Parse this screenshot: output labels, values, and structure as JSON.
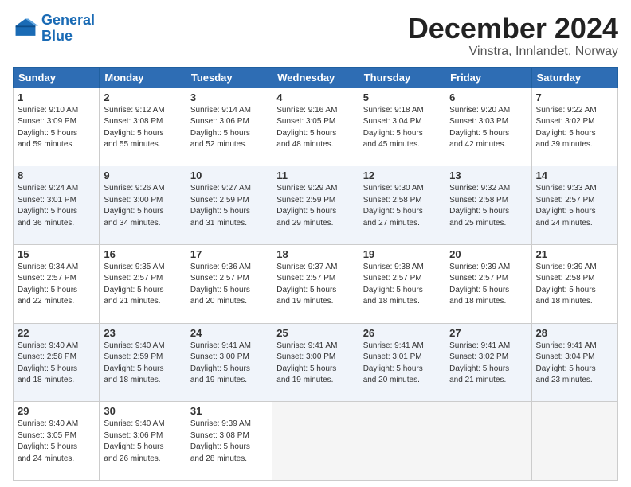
{
  "logo": {
    "line1": "General",
    "line2": "Blue"
  },
  "title": "December 2024",
  "subtitle": "Vinstra, Innlandet, Norway",
  "days_of_week": [
    "Sunday",
    "Monday",
    "Tuesday",
    "Wednesday",
    "Thursday",
    "Friday",
    "Saturday"
  ],
  "weeks": [
    [
      {
        "day": "1",
        "info": "Sunrise: 9:10 AM\nSunset: 3:09 PM\nDaylight: 5 hours\nand 59 minutes."
      },
      {
        "day": "2",
        "info": "Sunrise: 9:12 AM\nSunset: 3:08 PM\nDaylight: 5 hours\nand 55 minutes."
      },
      {
        "day": "3",
        "info": "Sunrise: 9:14 AM\nSunset: 3:06 PM\nDaylight: 5 hours\nand 52 minutes."
      },
      {
        "day": "4",
        "info": "Sunrise: 9:16 AM\nSunset: 3:05 PM\nDaylight: 5 hours\nand 48 minutes."
      },
      {
        "day": "5",
        "info": "Sunrise: 9:18 AM\nSunset: 3:04 PM\nDaylight: 5 hours\nand 45 minutes."
      },
      {
        "day": "6",
        "info": "Sunrise: 9:20 AM\nSunset: 3:03 PM\nDaylight: 5 hours\nand 42 minutes."
      },
      {
        "day": "7",
        "info": "Sunrise: 9:22 AM\nSunset: 3:02 PM\nDaylight: 5 hours\nand 39 minutes."
      }
    ],
    [
      {
        "day": "8",
        "info": "Sunrise: 9:24 AM\nSunset: 3:01 PM\nDaylight: 5 hours\nand 36 minutes."
      },
      {
        "day": "9",
        "info": "Sunrise: 9:26 AM\nSunset: 3:00 PM\nDaylight: 5 hours\nand 34 minutes."
      },
      {
        "day": "10",
        "info": "Sunrise: 9:27 AM\nSunset: 2:59 PM\nDaylight: 5 hours\nand 31 minutes."
      },
      {
        "day": "11",
        "info": "Sunrise: 9:29 AM\nSunset: 2:59 PM\nDaylight: 5 hours\nand 29 minutes."
      },
      {
        "day": "12",
        "info": "Sunrise: 9:30 AM\nSunset: 2:58 PM\nDaylight: 5 hours\nand 27 minutes."
      },
      {
        "day": "13",
        "info": "Sunrise: 9:32 AM\nSunset: 2:58 PM\nDaylight: 5 hours\nand 25 minutes."
      },
      {
        "day": "14",
        "info": "Sunrise: 9:33 AM\nSunset: 2:57 PM\nDaylight: 5 hours\nand 24 minutes."
      }
    ],
    [
      {
        "day": "15",
        "info": "Sunrise: 9:34 AM\nSunset: 2:57 PM\nDaylight: 5 hours\nand 22 minutes."
      },
      {
        "day": "16",
        "info": "Sunrise: 9:35 AM\nSunset: 2:57 PM\nDaylight: 5 hours\nand 21 minutes."
      },
      {
        "day": "17",
        "info": "Sunrise: 9:36 AM\nSunset: 2:57 PM\nDaylight: 5 hours\nand 20 minutes."
      },
      {
        "day": "18",
        "info": "Sunrise: 9:37 AM\nSunset: 2:57 PM\nDaylight: 5 hours\nand 19 minutes."
      },
      {
        "day": "19",
        "info": "Sunrise: 9:38 AM\nSunset: 2:57 PM\nDaylight: 5 hours\nand 18 minutes."
      },
      {
        "day": "20",
        "info": "Sunrise: 9:39 AM\nSunset: 2:57 PM\nDaylight: 5 hours\nand 18 minutes."
      },
      {
        "day": "21",
        "info": "Sunrise: 9:39 AM\nSunset: 2:58 PM\nDaylight: 5 hours\nand 18 minutes."
      }
    ],
    [
      {
        "day": "22",
        "info": "Sunrise: 9:40 AM\nSunset: 2:58 PM\nDaylight: 5 hours\nand 18 minutes."
      },
      {
        "day": "23",
        "info": "Sunrise: 9:40 AM\nSunset: 2:59 PM\nDaylight: 5 hours\nand 18 minutes."
      },
      {
        "day": "24",
        "info": "Sunrise: 9:41 AM\nSunset: 3:00 PM\nDaylight: 5 hours\nand 19 minutes."
      },
      {
        "day": "25",
        "info": "Sunrise: 9:41 AM\nSunset: 3:00 PM\nDaylight: 5 hours\nand 19 minutes."
      },
      {
        "day": "26",
        "info": "Sunrise: 9:41 AM\nSunset: 3:01 PM\nDaylight: 5 hours\nand 20 minutes."
      },
      {
        "day": "27",
        "info": "Sunrise: 9:41 AM\nSunset: 3:02 PM\nDaylight: 5 hours\nand 21 minutes."
      },
      {
        "day": "28",
        "info": "Sunrise: 9:41 AM\nSunset: 3:04 PM\nDaylight: 5 hours\nand 23 minutes."
      }
    ],
    [
      {
        "day": "29",
        "info": "Sunrise: 9:40 AM\nSunset: 3:05 PM\nDaylight: 5 hours\nand 24 minutes."
      },
      {
        "day": "30",
        "info": "Sunrise: 9:40 AM\nSunset: 3:06 PM\nDaylight: 5 hours\nand 26 minutes."
      },
      {
        "day": "31",
        "info": "Sunrise: 9:39 AM\nSunset: 3:08 PM\nDaylight: 5 hours\nand 28 minutes."
      },
      {
        "day": "",
        "info": ""
      },
      {
        "day": "",
        "info": ""
      },
      {
        "day": "",
        "info": ""
      },
      {
        "day": "",
        "info": ""
      }
    ]
  ]
}
